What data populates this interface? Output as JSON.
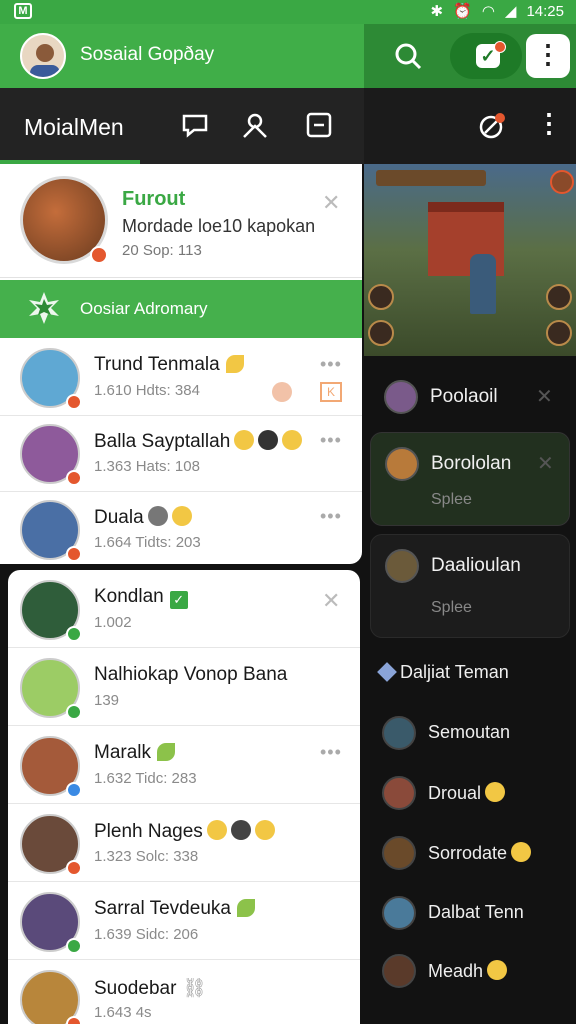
{
  "status_bar": {
    "time": "14:25"
  },
  "header": {
    "title": "Sosaial Gopðay"
  },
  "tabs": {
    "active_label": "MoialMen"
  },
  "featured": {
    "name": "Furout",
    "description": "Mordade loe10 kapokan",
    "meta": "20 Sop: 113"
  },
  "banner": {
    "label": "Oosiar Adromary"
  },
  "contacts_top": [
    {
      "name": "Trund Tenmala",
      "meta": "1.610 Hdts: 384",
      "avatar_color": "#5fa8d3"
    },
    {
      "name": "Balla Sayptallah",
      "meta": "1.363 Hats: 108",
      "avatar_color": "#8e5a9b"
    },
    {
      "name": "Duala",
      "meta": "1.664 Tidts: 203",
      "avatar_color": "#4a6fa5"
    }
  ],
  "contacts_bottom": [
    {
      "name": "Kondlan",
      "meta": "1.002",
      "avatar_color": "#2f5d3a"
    },
    {
      "name": "Nalhiokap Vonop Bana",
      "meta": "139",
      "avatar_color": "#9ccc65"
    },
    {
      "name": "Maralk",
      "meta": "1.632 Tidc: 283",
      "avatar_color": "#a45a3a"
    },
    {
      "name": "Plenh Nages",
      "meta": "1.323 Solc: 338",
      "avatar_color": "#6a4a3a"
    },
    {
      "name": "Sarral Tevdeuka",
      "meta": "1.639 Sidc: 206",
      "avatar_color": "#5a4a7a"
    },
    {
      "name": "Suodebar",
      "meta": "1.643 4s",
      "avatar_color": "#b8863b"
    }
  ],
  "right_cards": [
    {
      "name": "Poolaoil"
    },
    {
      "name": "Borololan",
      "sub": "Splee"
    },
    {
      "name": "Daalioulan",
      "sub": "Splee"
    }
  ],
  "right_section": {
    "title": "Daljiat Teman"
  },
  "right_list": [
    {
      "name": "Semoutan"
    },
    {
      "name": "Droual"
    },
    {
      "name": "Sorrodate"
    },
    {
      "name": "Dalbat Tenn"
    },
    {
      "name": "Meadh"
    }
  ],
  "colors": {
    "accent": "#3aa844",
    "dark": "#121212"
  }
}
